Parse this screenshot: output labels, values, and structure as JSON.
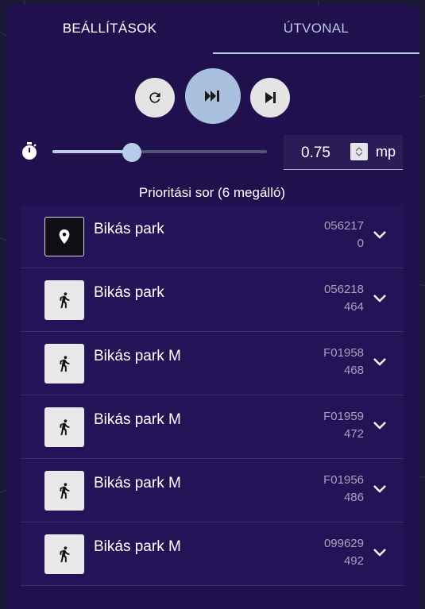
{
  "tabs": [
    {
      "label": "BEÁLLÍTÁSOK",
      "active": false
    },
    {
      "label": "ÚTVONAL",
      "active": true
    }
  ],
  "controls": {
    "restart_icon": "restart-icon",
    "fast_forward_icon": "fast-forward-icon",
    "skip_next_icon": "skip-next-icon"
  },
  "speed": {
    "value": "0.75",
    "unit": "mp",
    "slider_fraction": 0.37
  },
  "queue": {
    "title": "Prioritási sor (6 megálló)",
    "items": [
      {
        "name": "Bikás park",
        "code_line1": "056217",
        "code_line2": "0",
        "icon": "location-pin-icon",
        "icon_style": "dark"
      },
      {
        "name": "Bikás park",
        "code_line1": "056218",
        "code_line2": "464",
        "icon": "walking-person-icon",
        "icon_style": "light"
      },
      {
        "name": "Bikás park M",
        "code_line1": "F01958",
        "code_line2": "468",
        "icon": "walking-person-icon",
        "icon_style": "light"
      },
      {
        "name": "Bikás park M",
        "code_line1": "F01959",
        "code_line2": "472",
        "icon": "walking-person-icon",
        "icon_style": "light"
      },
      {
        "name": "Bikás park M",
        "code_line1": "F01956",
        "code_line2": "486",
        "icon": "walking-person-icon",
        "icon_style": "light"
      },
      {
        "name": "Bikás park M",
        "code_line1": "099629",
        "code_line2": "492",
        "icon": "walking-person-icon",
        "icon_style": "light"
      }
    ]
  },
  "colors": {
    "panel": "#20104e",
    "row": "#241457",
    "accent": "#a9c1de"
  }
}
